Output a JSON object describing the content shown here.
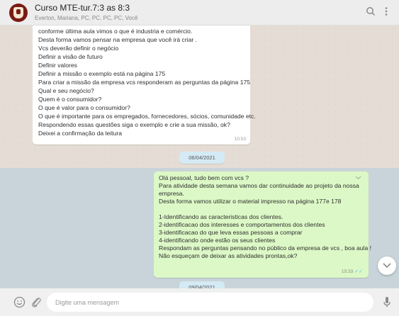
{
  "header": {
    "title": "Curso MTE-tur.7:3 as 8:3",
    "subtitle": "Everton, Mariana, PC, PC, PC, PC, Você",
    "search_icon": "search-icon",
    "menu_icon": "menu-icon"
  },
  "messages": {
    "incoming": {
      "lines": [
        "conforme  última aula vimos o que é industria e comércio.",
        "Desta forma vamos pensar na empresa que você irá criar .",
        "Vcs deverão definir o negócio",
        "Definir a visão de futuro",
        "Definir valores",
        "Definir a missão o exemplo está na página 175",
        "Para  criar a missão da empresa  vcs responderam as perguntas da página 175",
        "Qual e seu negócio?",
        "Quem é o consumidor?",
        "O que é valor para o consumidor?",
        "O que é importante para os empregados, fornecedores, sócios, comunidade etc.",
        "Respondendo essas questões siga o exemplo e crie a sua missão, ok?",
        "Deixei a confirmação da leitura"
      ],
      "time": "10:53"
    },
    "date_separator": "06/04/2021",
    "date_separator_2": "09/04/2021",
    "outgoing": {
      "lines": [
        "Olá pessoal, tudo bem com vcs ?",
        "Para atividade desta semana vamos dar continuidade ao projeto da nossa",
        "empresa.",
        "Desta forma vamos utilizar o material impresso na página 177e 178",
        "",
        " 1-Identificando as caracteristicas dos clientes.",
        "2-identificacao dos interesses e comportamentos dos clientes",
        "3-identificacao do que leva essas pessoas a comprar",
        "4-identificando onde estão os seus clientes",
        "Respondam as perguntas pensando no público da empresa de vcs , boa aula !",
        "Não esqueçam de deixar as atividades prontas,ok?"
      ],
      "time": "15:33",
      "checks": "✓✓"
    }
  },
  "footer": {
    "input_placeholder": "Digite uma mensagem",
    "emoji_icon": "emoji-icon",
    "attach_icon": "paperclip-icon",
    "mic_icon": "microphone-icon"
  },
  "colors": {
    "header_bg": "#ededed",
    "chat_bg": "#e5ddd5",
    "outgoing_bubble": "#dcf8c6",
    "incoming_bubble": "#ffffff",
    "read_check": "#4fc3f7"
  }
}
